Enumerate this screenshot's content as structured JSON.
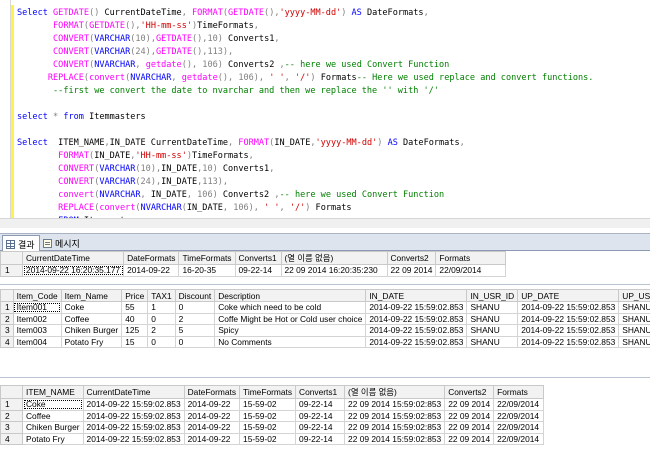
{
  "editor": {
    "lines": [
      [
        [
          "k",
          "Select "
        ],
        [
          "f",
          "GETDATE"
        ],
        [
          "o",
          "() "
        ],
        [
          "t",
          "CurrentDateTime"
        ],
        [
          "o",
          ", "
        ],
        [
          "f",
          "FORMAT"
        ],
        [
          "o",
          "("
        ],
        [
          "f",
          "GETDATE"
        ],
        [
          "o",
          "(),"
        ],
        [
          "s",
          "'yyyy-MM-dd'"
        ],
        [
          "o",
          ") "
        ],
        [
          "k",
          "AS "
        ],
        [
          "t",
          "DateFormats"
        ],
        [
          "o",
          ","
        ]
      ],
      [
        [
          "t",
          "       "
        ],
        [
          "f",
          "FORMAT"
        ],
        [
          "o",
          "("
        ],
        [
          "f",
          "GETDATE"
        ],
        [
          "o",
          "(),"
        ],
        [
          "s",
          "'HH-mm-ss'"
        ],
        [
          "o",
          ")"
        ],
        [
          "t",
          "TimeFormats"
        ],
        [
          "o",
          ","
        ]
      ],
      [
        [
          "t",
          "       "
        ],
        [
          "f",
          "CONVERT"
        ],
        [
          "o",
          "("
        ],
        [
          "k",
          "VARCHAR"
        ],
        [
          "o",
          "(10),"
        ],
        [
          "f",
          "GETDATE"
        ],
        [
          "o",
          "(),10) "
        ],
        [
          "t",
          "Converts1"
        ],
        [
          "o",
          ","
        ]
      ],
      [
        [
          "t",
          "       "
        ],
        [
          "f",
          "CONVERT"
        ],
        [
          "o",
          "("
        ],
        [
          "k",
          "VARCHAR"
        ],
        [
          "o",
          "(24),"
        ],
        [
          "f",
          "GETDATE"
        ],
        [
          "o",
          "(),113),"
        ]
      ],
      [
        [
          "t",
          "       "
        ],
        [
          "f",
          "CONVERT"
        ],
        [
          "o",
          "("
        ],
        [
          "k",
          "NVARCHAR"
        ],
        [
          "o",
          ", "
        ],
        [
          "f",
          "getdate"
        ],
        [
          "o",
          "(), 106) "
        ],
        [
          "t",
          "Converts2 "
        ],
        [
          "o",
          ","
        ],
        [
          "c",
          "-- here we used Convert Function"
        ]
      ],
      [
        [
          "t",
          "      "
        ],
        [
          "f",
          "REPLACE"
        ],
        [
          "o",
          "("
        ],
        [
          "f",
          "convert"
        ],
        [
          "o",
          "("
        ],
        [
          "k",
          "NVARCHAR"
        ],
        [
          "o",
          ", "
        ],
        [
          "f",
          "getdate"
        ],
        [
          "o",
          "(), 106), "
        ],
        [
          "s",
          "' '"
        ],
        [
          "o",
          ", "
        ],
        [
          "s",
          "'/'"
        ],
        [
          "o",
          ") "
        ],
        [
          "t",
          "Formats"
        ],
        [
          "c",
          "-- Here we used replace and convert functions."
        ]
      ],
      [
        [
          "t",
          "       "
        ],
        [
          "c",
          "--first we convert the date to nvarchar and then we replace the '' with '/'"
        ]
      ],
      [
        [
          "t",
          " "
        ]
      ],
      [
        [
          "k",
          "select "
        ],
        [
          "o",
          "* "
        ],
        [
          "k",
          "from "
        ],
        [
          "t",
          "Itemmasters"
        ]
      ],
      [
        [
          "t",
          " "
        ]
      ],
      [
        [
          "k",
          "Select  "
        ],
        [
          "t",
          "ITEM_NAME"
        ],
        [
          "o",
          ","
        ],
        [
          "t",
          "IN_DATE CurrentDateTime"
        ],
        [
          "o",
          ", "
        ],
        [
          "f",
          "FORMAT"
        ],
        [
          "o",
          "("
        ],
        [
          "t",
          "IN_DATE"
        ],
        [
          "o",
          ","
        ],
        [
          "s",
          "'yyyy-MM-dd'"
        ],
        [
          "o",
          ") "
        ],
        [
          "k",
          "AS "
        ],
        [
          "t",
          "DateFormats"
        ],
        [
          "o",
          ","
        ]
      ],
      [
        [
          "t",
          "        "
        ],
        [
          "f",
          "FORMAT"
        ],
        [
          "o",
          "("
        ],
        [
          "t",
          "IN_DATE"
        ],
        [
          "o",
          ","
        ],
        [
          "s",
          "'HH-mm-ss'"
        ],
        [
          "o",
          ")"
        ],
        [
          "t",
          "TimeFormats"
        ],
        [
          "o",
          ","
        ]
      ],
      [
        [
          "t",
          "        "
        ],
        [
          "f",
          "CONVERT"
        ],
        [
          "o",
          "("
        ],
        [
          "k",
          "VARCHAR"
        ],
        [
          "o",
          "(10),"
        ],
        [
          "t",
          "IN_DATE"
        ],
        [
          "o",
          ",10) "
        ],
        [
          "t",
          "Converts1"
        ],
        [
          "o",
          ","
        ]
      ],
      [
        [
          "t",
          "        "
        ],
        [
          "f",
          "CONVERT"
        ],
        [
          "o",
          "("
        ],
        [
          "k",
          "VARCHAR"
        ],
        [
          "o",
          "(24),"
        ],
        [
          "t",
          "IN_DATE"
        ],
        [
          "o",
          ",113),"
        ]
      ],
      [
        [
          "t",
          "        "
        ],
        [
          "f",
          "convert"
        ],
        [
          "o",
          "("
        ],
        [
          "k",
          "NVARCHAR"
        ],
        [
          "o",
          ", "
        ],
        [
          "t",
          "IN_DATE"
        ],
        [
          "o",
          ", 106) "
        ],
        [
          "t",
          "Converts2 "
        ],
        [
          "o",
          ","
        ],
        [
          "c",
          "-- here we used Convert Function"
        ]
      ],
      [
        [
          "t",
          "        "
        ],
        [
          "f",
          "REPLACE"
        ],
        [
          "o",
          "("
        ],
        [
          "f",
          "convert"
        ],
        [
          "o",
          "("
        ],
        [
          "k",
          "NVARCHAR"
        ],
        [
          "o",
          "("
        ],
        [
          "t",
          "IN_DATE"
        ],
        [
          "o",
          ", 106), "
        ],
        [
          "s",
          "' '"
        ],
        [
          "o",
          ", "
        ],
        [
          "s",
          "'/'"
        ],
        [
          "o",
          ") "
        ],
        [
          "t",
          "Formats"
        ]
      ],
      [
        [
          "t",
          "        "
        ],
        [
          "k",
          "FROM "
        ],
        [
          "t",
          "Itemmasters"
        ]
      ]
    ]
  },
  "tabs": [
    {
      "label": "결과",
      "icon": "grid-icon"
    },
    {
      "label": "메시지",
      "icon": "message-icon"
    }
  ],
  "grid1": {
    "columns": [
      "",
      "CurrentDateTime",
      "DateFormats",
      "TimeFormats",
      "Converts1",
      "(열 이름 없음)",
      "Converts2",
      "Formats"
    ],
    "rows": [
      [
        "1",
        "2014-09-22 16:20:35.177",
        "2014-09-22",
        "16-20-35",
        "09-22-14",
        "22 09 2014 16:20:35:230",
        "22 09 2014",
        "22/09/2014"
      ]
    ]
  },
  "grid2": {
    "columns": [
      "",
      "Item_Code",
      "Item_Name",
      "Price",
      "TAX1",
      "Discount",
      "Description",
      "IN_DATE",
      "IN_USR_ID",
      "UP_DATE",
      "UP_USR_ID"
    ],
    "rows": [
      [
        "1",
        "Item001",
        "Coke",
        "55",
        "1",
        "0",
        "Coke which need to be cold",
        "2014-09-22 15:59:02.853",
        "SHANU",
        "2014-09-22 15:59:02.853",
        "SHANU"
      ],
      [
        "2",
        "Item002",
        "Coffee",
        "40",
        "0",
        "2",
        "Coffe Might be Hot or Cold user choice",
        "2014-09-22 15:59:02.853",
        "SHANU",
        "2014-09-22 15:59:02.853",
        "SHANU"
      ],
      [
        "3",
        "Item003",
        "Chiken Burger",
        "125",
        "2",
        "5",
        "Spicy",
        "2014-09-22 15:59:02.853",
        "SHANU",
        "2014-09-22 15:59:02.853",
        "SHANU"
      ],
      [
        "4",
        "Item004",
        "Potato Fry",
        "15",
        "0",
        "0",
        "No Comments",
        "2014-09-22 15:59:02.853",
        "SHANU",
        "2014-09-22 15:59:02.853",
        "SHANU"
      ]
    ]
  },
  "grid3": {
    "columns": [
      "",
      "ITEM_NAME",
      "CurrentDateTime",
      "DateFormats",
      "TimeFormats",
      "Converts1",
      "(열 이름 없음)",
      "Converts2",
      "Formats"
    ],
    "rows": [
      [
        "1",
        "Coke",
        "2014-09-22 15:59:02.853",
        "2014-09-22",
        "15-59-02",
        "09-22-14",
        "22 09 2014 15:59:02:853",
        "22 09 2014",
        "22/09/2014"
      ],
      [
        "2",
        "Coffee",
        "2014-09-22 15:59:02.853",
        "2014-09-22",
        "15-59-02",
        "09-22-14",
        "22 09 2014 15:59:02:853",
        "22 09 2014",
        "22/09/2014"
      ],
      [
        "3",
        "Chiken Burger",
        "2014-09-22 15:59:02.853",
        "2014-09-22",
        "15-59-02",
        "09-22-14",
        "22 09 2014 15:59:02:853",
        "22 09 2014",
        "22/09/2014"
      ],
      [
        "4",
        "Potato Fry",
        "2014-09-22 15:59:02.853",
        "2014-09-22",
        "15-59-02",
        "09-22-14",
        "22 09 2014 15:59:02:853",
        "22 09 2014",
        "22/09/2014"
      ]
    ]
  }
}
